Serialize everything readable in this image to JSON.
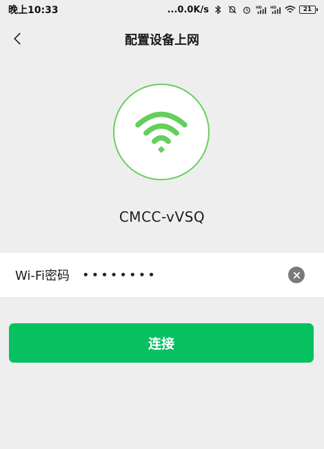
{
  "status_bar": {
    "time": "晚上10:33",
    "network_speed": "...0.0K/s",
    "battery_level": "21",
    "icons": [
      "bluetooth-icon",
      "do-not-disturb-icon",
      "alarm-icon",
      "signal-hd-icon",
      "signal-hd-icon",
      "wifi-icon",
      "battery-icon"
    ]
  },
  "header": {
    "title": "配置设备上网",
    "back_icon": "chevron-left-icon"
  },
  "wifi": {
    "icon": "wifi-icon",
    "ssid": "CMCC-vVSQ",
    "accent_color": "#65cf5b"
  },
  "password": {
    "label": "Wi-Fi密码",
    "value": "••••••••",
    "clear_icon": "clear-icon"
  },
  "connect": {
    "label": "连接",
    "color": "#07c160"
  }
}
